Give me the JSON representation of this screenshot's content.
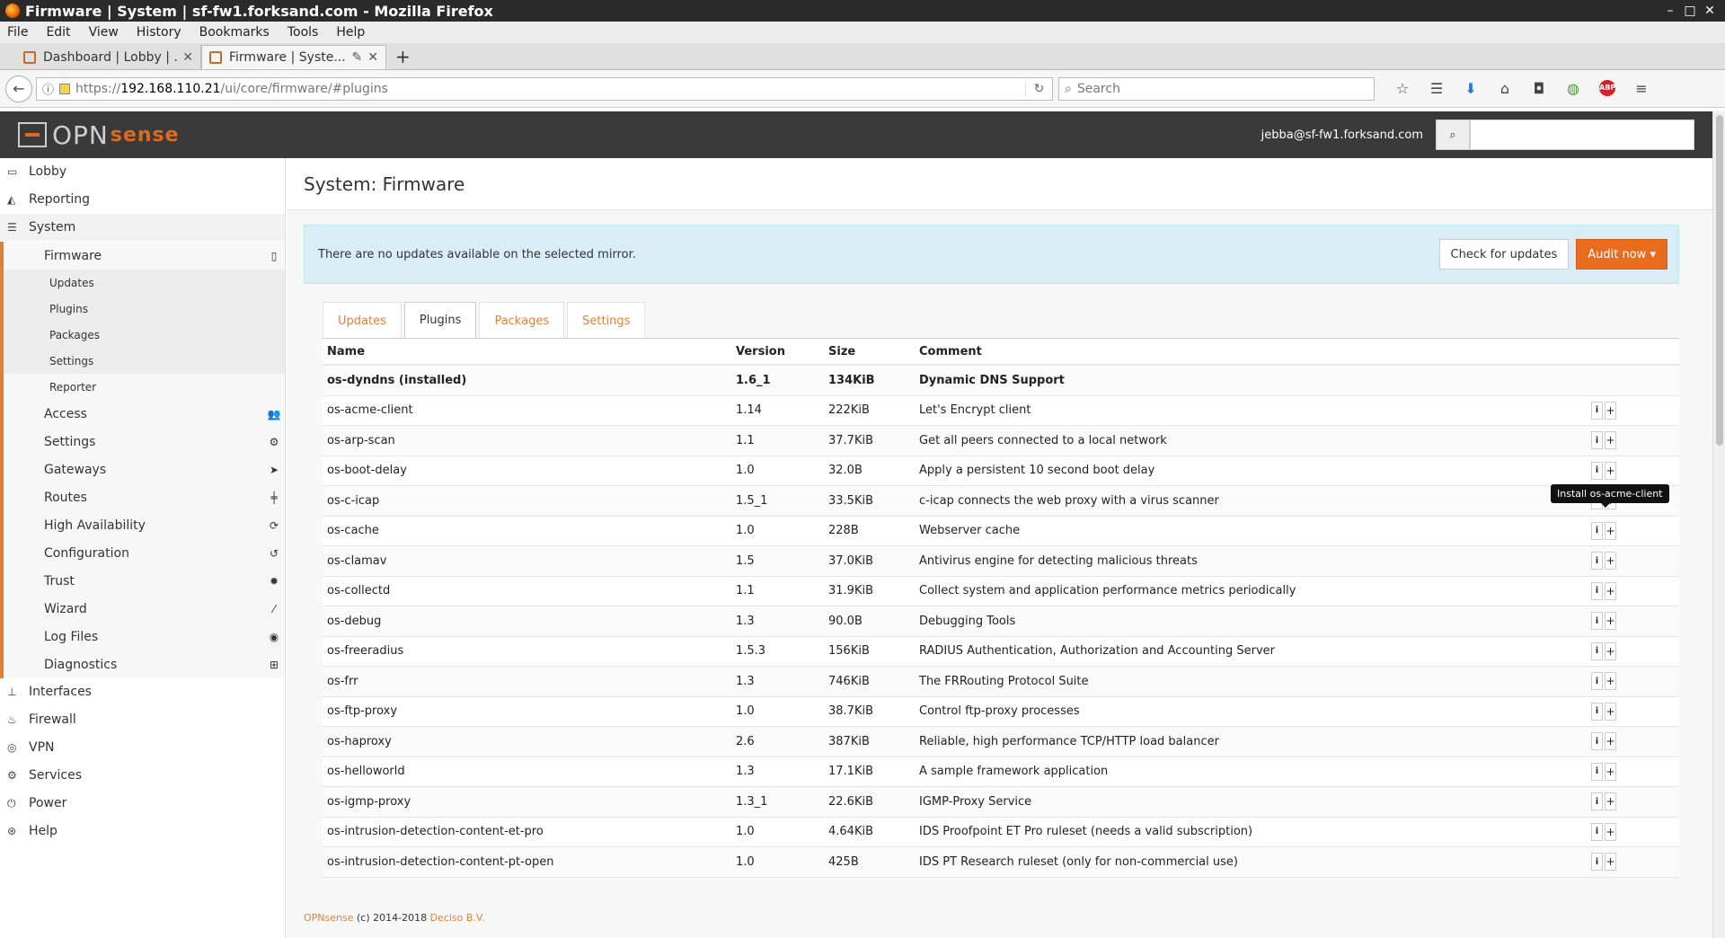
{
  "window": {
    "title": "Firmware | System | sf-fw1.forksand.com - Mozilla Firefox"
  },
  "menubar": [
    "File",
    "Edit",
    "View",
    "History",
    "Bookmarks",
    "Tools",
    "Help"
  ],
  "tabs": [
    {
      "label": "Dashboard | Lobby | ...",
      "active": false
    },
    {
      "label": "Firmware | Syste...",
      "active": true
    }
  ],
  "url": {
    "prefix": "https://",
    "host": "192.168.110.21",
    "path": "/ui/core/firmware/#plugins"
  },
  "search": {
    "placeholder": "Search"
  },
  "header": {
    "user": "jebba@sf-fw1.forksand.com"
  },
  "sidebar": {
    "lobby": "Lobby",
    "reporting": "Reporting",
    "system": "System",
    "firmware": "Firmware",
    "firmware_sub": [
      "Updates",
      "Plugins",
      "Packages",
      "Settings",
      "Reporter"
    ],
    "system_sub": [
      {
        "label": "Access",
        "icon": "users-icon"
      },
      {
        "label": "Settings",
        "icon": "cogs-icon"
      },
      {
        "label": "Gateways",
        "icon": "location-arrow-icon"
      },
      {
        "label": "Routes",
        "icon": "signs-icon"
      },
      {
        "label": "High Availability",
        "icon": "refresh-icon"
      },
      {
        "label": "Configuration",
        "icon": "history-icon"
      },
      {
        "label": "Trust",
        "icon": "certificate-icon"
      },
      {
        "label": "Wizard",
        "icon": "magic-icon"
      },
      {
        "label": "Log Files",
        "icon": "eye-icon"
      },
      {
        "label": "Diagnostics",
        "icon": "medkit-icon"
      }
    ],
    "bottom": [
      {
        "label": "Interfaces",
        "icon": "sitemap-icon"
      },
      {
        "label": "Firewall",
        "icon": "fire-icon"
      },
      {
        "label": "VPN",
        "icon": "globe-icon"
      },
      {
        "label": "Services",
        "icon": "cog-icon"
      },
      {
        "label": "Power",
        "icon": "plug-icon"
      },
      {
        "label": "Help",
        "icon": "life-ring-icon"
      }
    ]
  },
  "page": {
    "title": "System: Firmware",
    "alert": "There are no updates available on the selected mirror.",
    "check_button": "Check for updates",
    "audit_button": "Audit now",
    "tabs": [
      "Updates",
      "Plugins",
      "Packages",
      "Settings"
    ],
    "tooltip": "Install os-acme-client"
  },
  "table": {
    "headers": [
      "Name",
      "Version",
      "Size",
      "Comment"
    ],
    "rows": [
      {
        "name": "os-dyndns (installed)",
        "version": "1.6_1",
        "size": "134KiB",
        "comment": "Dynamic DNS Support",
        "installed": true
      },
      {
        "name": "os-acme-client",
        "version": "1.14",
        "size": "222KiB",
        "comment": "Let's Encrypt client"
      },
      {
        "name": "os-arp-scan",
        "version": "1.1",
        "size": "37.7KiB",
        "comment": "Get all peers connected to a local network"
      },
      {
        "name": "os-boot-delay",
        "version": "1.0",
        "size": "32.0B",
        "comment": "Apply a persistent 10 second boot delay"
      },
      {
        "name": "os-c-icap",
        "version": "1.5_1",
        "size": "33.5KiB",
        "comment": "c-icap connects the web proxy with a virus scanner"
      },
      {
        "name": "os-cache",
        "version": "1.0",
        "size": "228B",
        "comment": "Webserver cache"
      },
      {
        "name": "os-clamav",
        "version": "1.5",
        "size": "37.0KiB",
        "comment": "Antivirus engine for detecting malicious threats"
      },
      {
        "name": "os-collectd",
        "version": "1.1",
        "size": "31.9KiB",
        "comment": "Collect system and application performance metrics periodically"
      },
      {
        "name": "os-debug",
        "version": "1.3",
        "size": "90.0B",
        "comment": "Debugging Tools"
      },
      {
        "name": "os-freeradius",
        "version": "1.5.3",
        "size": "156KiB",
        "comment": "RADIUS Authentication, Authorization and Accounting Server"
      },
      {
        "name": "os-frr",
        "version": "1.3",
        "size": "746KiB",
        "comment": "The FRRouting Protocol Suite"
      },
      {
        "name": "os-ftp-proxy",
        "version": "1.0",
        "size": "38.7KiB",
        "comment": "Control ftp-proxy processes"
      },
      {
        "name": "os-haproxy",
        "version": "2.6",
        "size": "387KiB",
        "comment": "Reliable, high performance TCP/HTTP load balancer"
      },
      {
        "name": "os-helloworld",
        "version": "1.3",
        "size": "17.1KiB",
        "comment": "A sample framework application"
      },
      {
        "name": "os-igmp-proxy",
        "version": "1.3_1",
        "size": "22.6KiB",
        "comment": "IGMP-Proxy Service"
      },
      {
        "name": "os-intrusion-detection-content-et-pro",
        "version": "1.0",
        "size": "4.64KiB",
        "comment": "IDS Proofpoint ET Pro ruleset (needs a valid subscription)"
      },
      {
        "name": "os-intrusion-detection-content-pt-open",
        "version": "1.0",
        "size": "425B",
        "comment": "IDS PT Research ruleset (only for non-commercial use)"
      }
    ]
  },
  "footer": {
    "brand": "OPNsense",
    "text": " (c) 2014-2018 ",
    "company": "Deciso B.V."
  },
  "colors": {
    "accent": "#e0813a",
    "topnav": "#3a3a3a",
    "alert_bg": "#d9edf7"
  }
}
